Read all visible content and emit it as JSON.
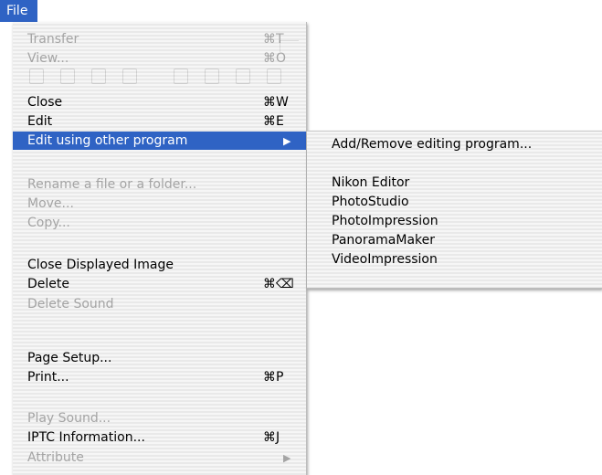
{
  "menu_bar": {
    "title": "File"
  },
  "file_menu": {
    "items": [
      {
        "label": "Transfer",
        "shortcut": "⌘T",
        "enabled": false
      },
      {
        "label": "View...",
        "shortcut": "⌘O",
        "enabled": false
      },
      {
        "label": "Close",
        "shortcut": "⌘W",
        "enabled": true
      },
      {
        "label": "Edit",
        "shortcut": "⌘E",
        "enabled": true
      },
      {
        "label": "Edit using other program",
        "submenu_arrow": "▶",
        "enabled": true,
        "highlighted": true
      },
      {
        "label": "Rename a file or a folder...",
        "enabled": false
      },
      {
        "label": "Move...",
        "enabled": false
      },
      {
        "label": "Copy...",
        "enabled": false
      },
      {
        "label": "Close Displayed Image",
        "enabled": true
      },
      {
        "label": "Delete",
        "shortcut": "⌘⌫",
        "enabled": true
      },
      {
        "label": "Delete Sound",
        "enabled": false
      },
      {
        "label": "Page Setup...",
        "enabled": true
      },
      {
        "label": "Print...",
        "shortcut": "⌘P",
        "enabled": true
      },
      {
        "label": "Play Sound...",
        "enabled": false
      },
      {
        "label": "IPTC Information...",
        "shortcut": "⌘J",
        "enabled": true
      },
      {
        "label": "Attribute",
        "submenu_arrow": "▶",
        "enabled": false
      }
    ]
  },
  "submenu": {
    "items": [
      {
        "label": "Add/Remove editing program...",
        "enabled": true
      },
      {
        "label": "Nikon Editor",
        "enabled": true
      },
      {
        "label": "PhotoStudio",
        "enabled": true
      },
      {
        "label": "PhotoImpression",
        "enabled": true
      },
      {
        "label": "PanoramaMaker",
        "enabled": true
      },
      {
        "label": "VideoImpression",
        "enabled": true
      }
    ]
  },
  "colors": {
    "highlight": "#2f63c4",
    "disabled_text": "#a4a4a4",
    "menu_background": "#f4f4f4"
  }
}
